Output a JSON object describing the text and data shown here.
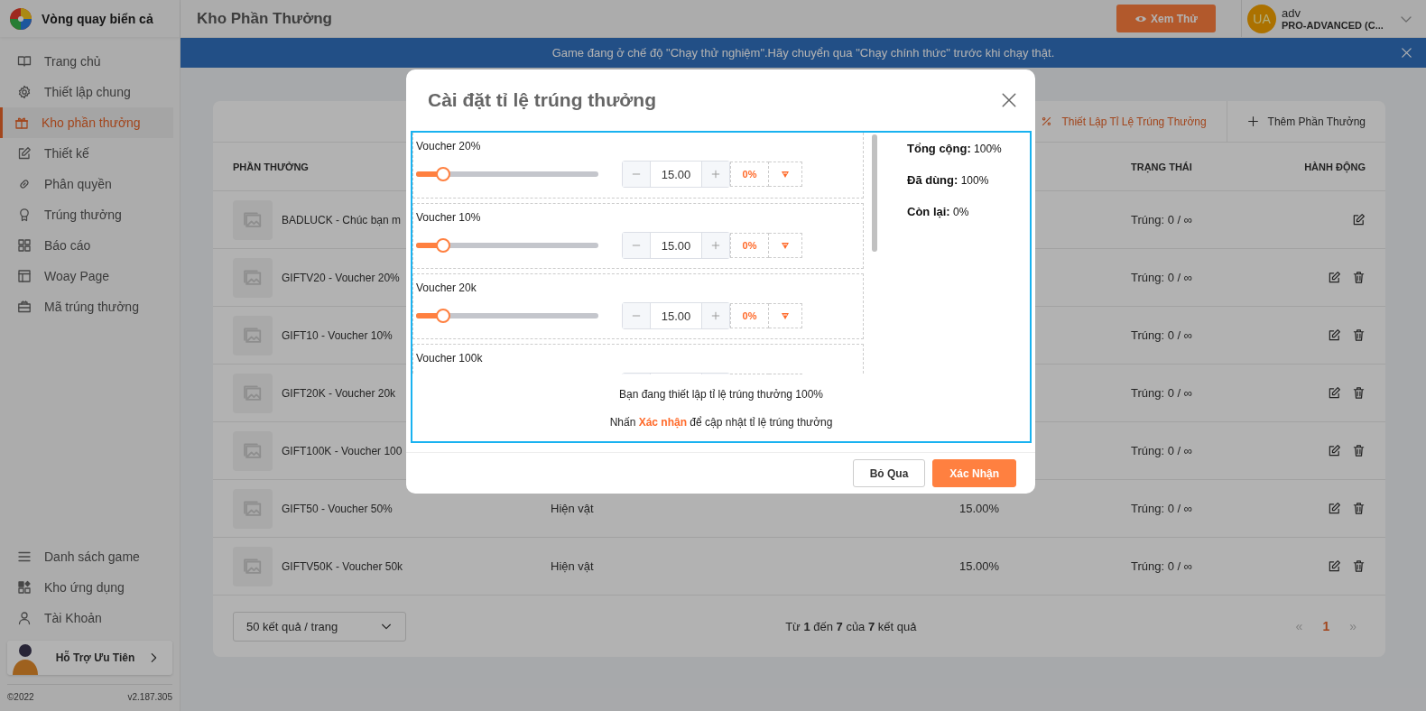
{
  "sidebar": {
    "app_name": "Vòng quay biển cả",
    "items": [
      {
        "label": "Trang chủ",
        "selected": false
      },
      {
        "label": "Thiết lập chung",
        "selected": false
      },
      {
        "label": "Kho phần thưởng",
        "selected": true
      },
      {
        "label": "Thiết kế",
        "selected": false
      },
      {
        "label": "Phân quyền",
        "selected": false
      },
      {
        "label": "Trúng thưởng",
        "selected": false
      },
      {
        "label": "Báo cáo",
        "selected": false
      },
      {
        "label": "Woay Page",
        "selected": false
      },
      {
        "label": "Mã trúng thưởng",
        "selected": false
      }
    ],
    "bottom_items": [
      {
        "label": "Danh sách game",
        "selected": false
      },
      {
        "label": "Kho ứng dụng",
        "selected": false
      },
      {
        "label": "Tài Khoản",
        "selected": false
      }
    ],
    "support": {
      "label": "Hỗ Trợ Ưu Tiên"
    },
    "copyright": "©2022",
    "version": "v2.187.305"
  },
  "header": {
    "title": "Kho Phần Thưởng",
    "preview_button": "Xem Thử",
    "user": {
      "initials": "UA",
      "name": "adv",
      "plan": "PRO-ADVANCED (C..."
    }
  },
  "banner": {
    "message": "Game đang ở chế độ \"Chạy thử nghiệm\".Hãy chuyển qua \"Chạy chính thức\" trước khi chạy thật."
  },
  "card": {
    "toolbar": [
      {
        "label": "Thiết Lập Tỉ Lệ Trúng Thưởng",
        "kind": "rate"
      },
      {
        "label": "Thêm Phần Thưởng",
        "kind": "add"
      }
    ],
    "columns": {
      "reward": "PHẦN THƯỞNG",
      "status": "TRẠNG THÁI",
      "actions": "HÀNH ĐỘNG"
    },
    "rows": [
      {
        "name": "BADLUCK - Chúc bạn m",
        "status": "Trúng: 0 / ∞",
        "deletable": false
      },
      {
        "name": "GIFTV20 - Voucher 20%",
        "status": "Trúng: 0 / ∞",
        "deletable": true
      },
      {
        "name": "GIFT10 - Voucher 10%",
        "status": "Trúng: 0 / ∞",
        "deletable": true
      },
      {
        "name": "GIFT20K - Voucher 20k",
        "status": "Trúng: 0 / ∞",
        "deletable": true
      },
      {
        "name": "GIFT100K - Voucher 100",
        "status": "Trúng: 0 / ∞",
        "deletable": true
      },
      {
        "name": "GIFT50 - Voucher 50%",
        "type": "Hiện vật",
        "rate": "15.00%",
        "status": "Trúng: 0 / ∞",
        "deletable": true
      },
      {
        "name": "GIFTV50K - Voucher 50k",
        "type": "Hiện vật",
        "rate": "15.00%",
        "status": "Trúng: 0 / ∞",
        "deletable": true
      }
    ],
    "pagination": {
      "page_size": "50 kết quả / trang",
      "summary": "Từ **1** đến **7** của **7** kết quả",
      "prev": "«",
      "next": "»",
      "pages": [
        {
          "label": "1",
          "selected": true
        }
      ]
    }
  },
  "modal": {
    "title": "Cài đặt tỉ lệ trúng thưởng",
    "items": [
      {
        "label": "Voucher 20%",
        "level": 0.15,
        "value": "15.00",
        "share": "0%"
      },
      {
        "label": "Voucher 10%",
        "level": 0.15,
        "value": "15.00",
        "share": "0%"
      },
      {
        "label": "Voucher 20k",
        "level": 0.15,
        "value": "15.00",
        "share": "0%"
      },
      {
        "label": "Voucher 100k"
      }
    ],
    "summary": [
      "**Tổng cộng:** 100%",
      "**Đã dùng:** 100%",
      "**Còn lại:** 0%"
    ],
    "note": "Bạn đang thiết lập tỉ lệ trúng thưởng 100%",
    "hint": "Nhấn **Xác nhận** để cập nhật tỉ lệ trúng thưởng",
    "buttons": [
      {
        "label": "Bỏ Qua",
        "kind": "secondary"
      },
      {
        "label": "Xác Nhận",
        "kind": "primary"
      }
    ]
  }
}
